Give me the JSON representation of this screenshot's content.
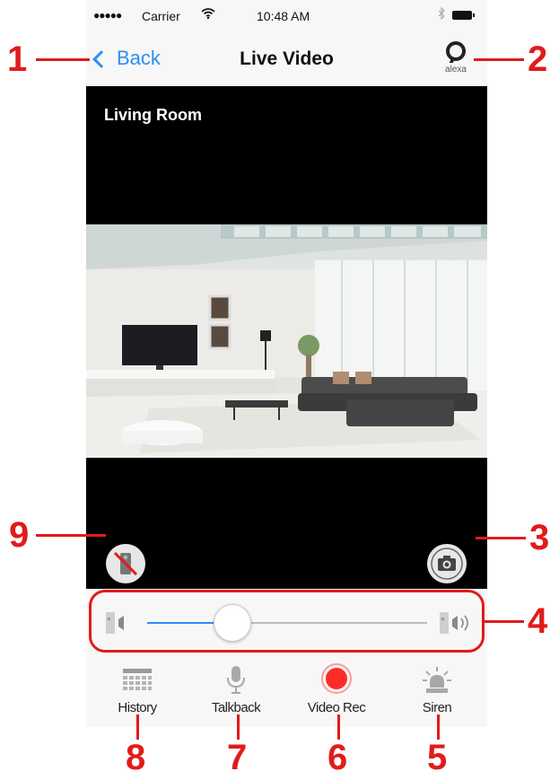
{
  "status_bar": {
    "signal": "●●●●●",
    "carrier": "Carrier",
    "time": "10:48 AM"
  },
  "nav": {
    "back_label": "Back",
    "title": "Live Video",
    "alexa_label": "alexa"
  },
  "video": {
    "room_label": "Living Room"
  },
  "volume": {
    "level": 0.3
  },
  "tabs": [
    {
      "label": "History",
      "icon": "calendar-grid-icon"
    },
    {
      "label": "Talkback",
      "icon": "microphone-icon"
    },
    {
      "label": "Video Rec",
      "icon": "record-icon"
    },
    {
      "label": "Siren",
      "icon": "siren-icon"
    }
  ],
  "callouts": [
    "1",
    "2",
    "3",
    "4",
    "5",
    "6",
    "7",
    "8",
    "9"
  ],
  "colors": {
    "accent": "#2b8ff3",
    "callout": "#e01b1b",
    "record": "#ff2b2b",
    "video_bg": "#000000"
  }
}
